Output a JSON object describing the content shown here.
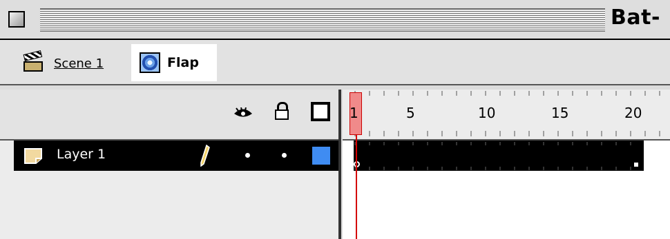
{
  "window": {
    "title": "Bat-"
  },
  "breadcrumb": {
    "scene": {
      "label": "Scene 1",
      "icon": "clapperboard-icon"
    },
    "symbol": {
      "label": "Flap",
      "icon": "movie-clip-symbol-icon"
    }
  },
  "layer_header": {
    "icons": [
      "eye-icon",
      "lock-icon",
      "outline-icon"
    ]
  },
  "layers": [
    {
      "name": "Layer 1",
      "selected": true,
      "editing": true,
      "visible": true,
      "locked": false,
      "outline_color": "#3f8cf2"
    }
  ],
  "timeline": {
    "frame_numbers": [
      "1",
      "5",
      "10",
      "15",
      "20"
    ],
    "current_frame": 1,
    "playhead_color": "#d40000"
  },
  "colors": {
    "selection": "#000000",
    "layer_color": "#3f8cf2",
    "playhead_highlight": "#f08a8a"
  }
}
